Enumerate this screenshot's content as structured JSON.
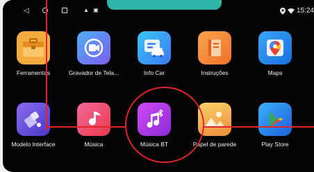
{
  "status_bar": {
    "back_glyph": "◁",
    "notification_icons": "▲ ▣",
    "time": "15:24",
    "location_icon": "location-icon",
    "wifi_icon": "wifi-icon"
  },
  "apps": [
    {
      "label": "Ferramentas",
      "icon": "toolbox-icon",
      "color": "#f0a23a"
    },
    {
      "label": "Gravador de Tela...",
      "icon": "screen-recorder-icon",
      "color": "#7b5cf0"
    },
    {
      "label": "Info Car",
      "icon": "car-info-icon",
      "color": "#3aa0f0"
    },
    {
      "label": "Instruções",
      "icon": "manual-book-icon",
      "color": "#f5862a"
    },
    {
      "label": "Maps",
      "icon": "maps-icon",
      "color": "#1e88f0"
    },
    {
      "label": "Modelo Interface",
      "icon": "interface-theme-icon",
      "color": "#6b4fd8"
    },
    {
      "label": "Música",
      "icon": "music-note-icon",
      "color": "#e83a6a"
    },
    {
      "label": "Música BT",
      "icon": "bluetooth-music-icon",
      "color": "#a63cf0"
    },
    {
      "label": "Papel de parede",
      "icon": "wallpaper-icon",
      "color": "#f7b04a"
    },
    {
      "label": "Play Store",
      "icon": "play-store-icon",
      "color": "#2f7cf0"
    }
  ],
  "annotation": {
    "color": "#e0242c"
  }
}
